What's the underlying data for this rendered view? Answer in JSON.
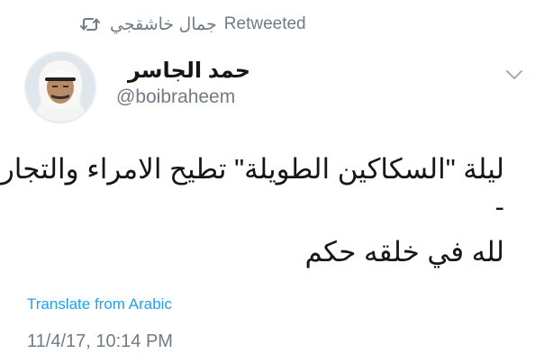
{
  "retweet": {
    "icon": "retweet-icon",
    "name": "جمال خاشقجي",
    "label": "Retweeted"
  },
  "author": {
    "display_name": "حمد الجاسر",
    "handle": "@boibraheem",
    "avatar": "avatar-photo"
  },
  "menu": {
    "icon": "chevron-down-icon"
  },
  "tweet": {
    "line1": "ليلة \"السكاكين الطويلة\" تطيح الامراء والتجار",
    "line2": "-",
    "line3": "لله في خلقه حكم"
  },
  "translate": {
    "label": "Translate from Arabic"
  },
  "timestamp": "11/4/17, 10:14 PM",
  "colors": {
    "text_primary": "#14171a",
    "text_secondary": "#707b85",
    "link": "#1da1f2",
    "background": "#ffffff"
  }
}
